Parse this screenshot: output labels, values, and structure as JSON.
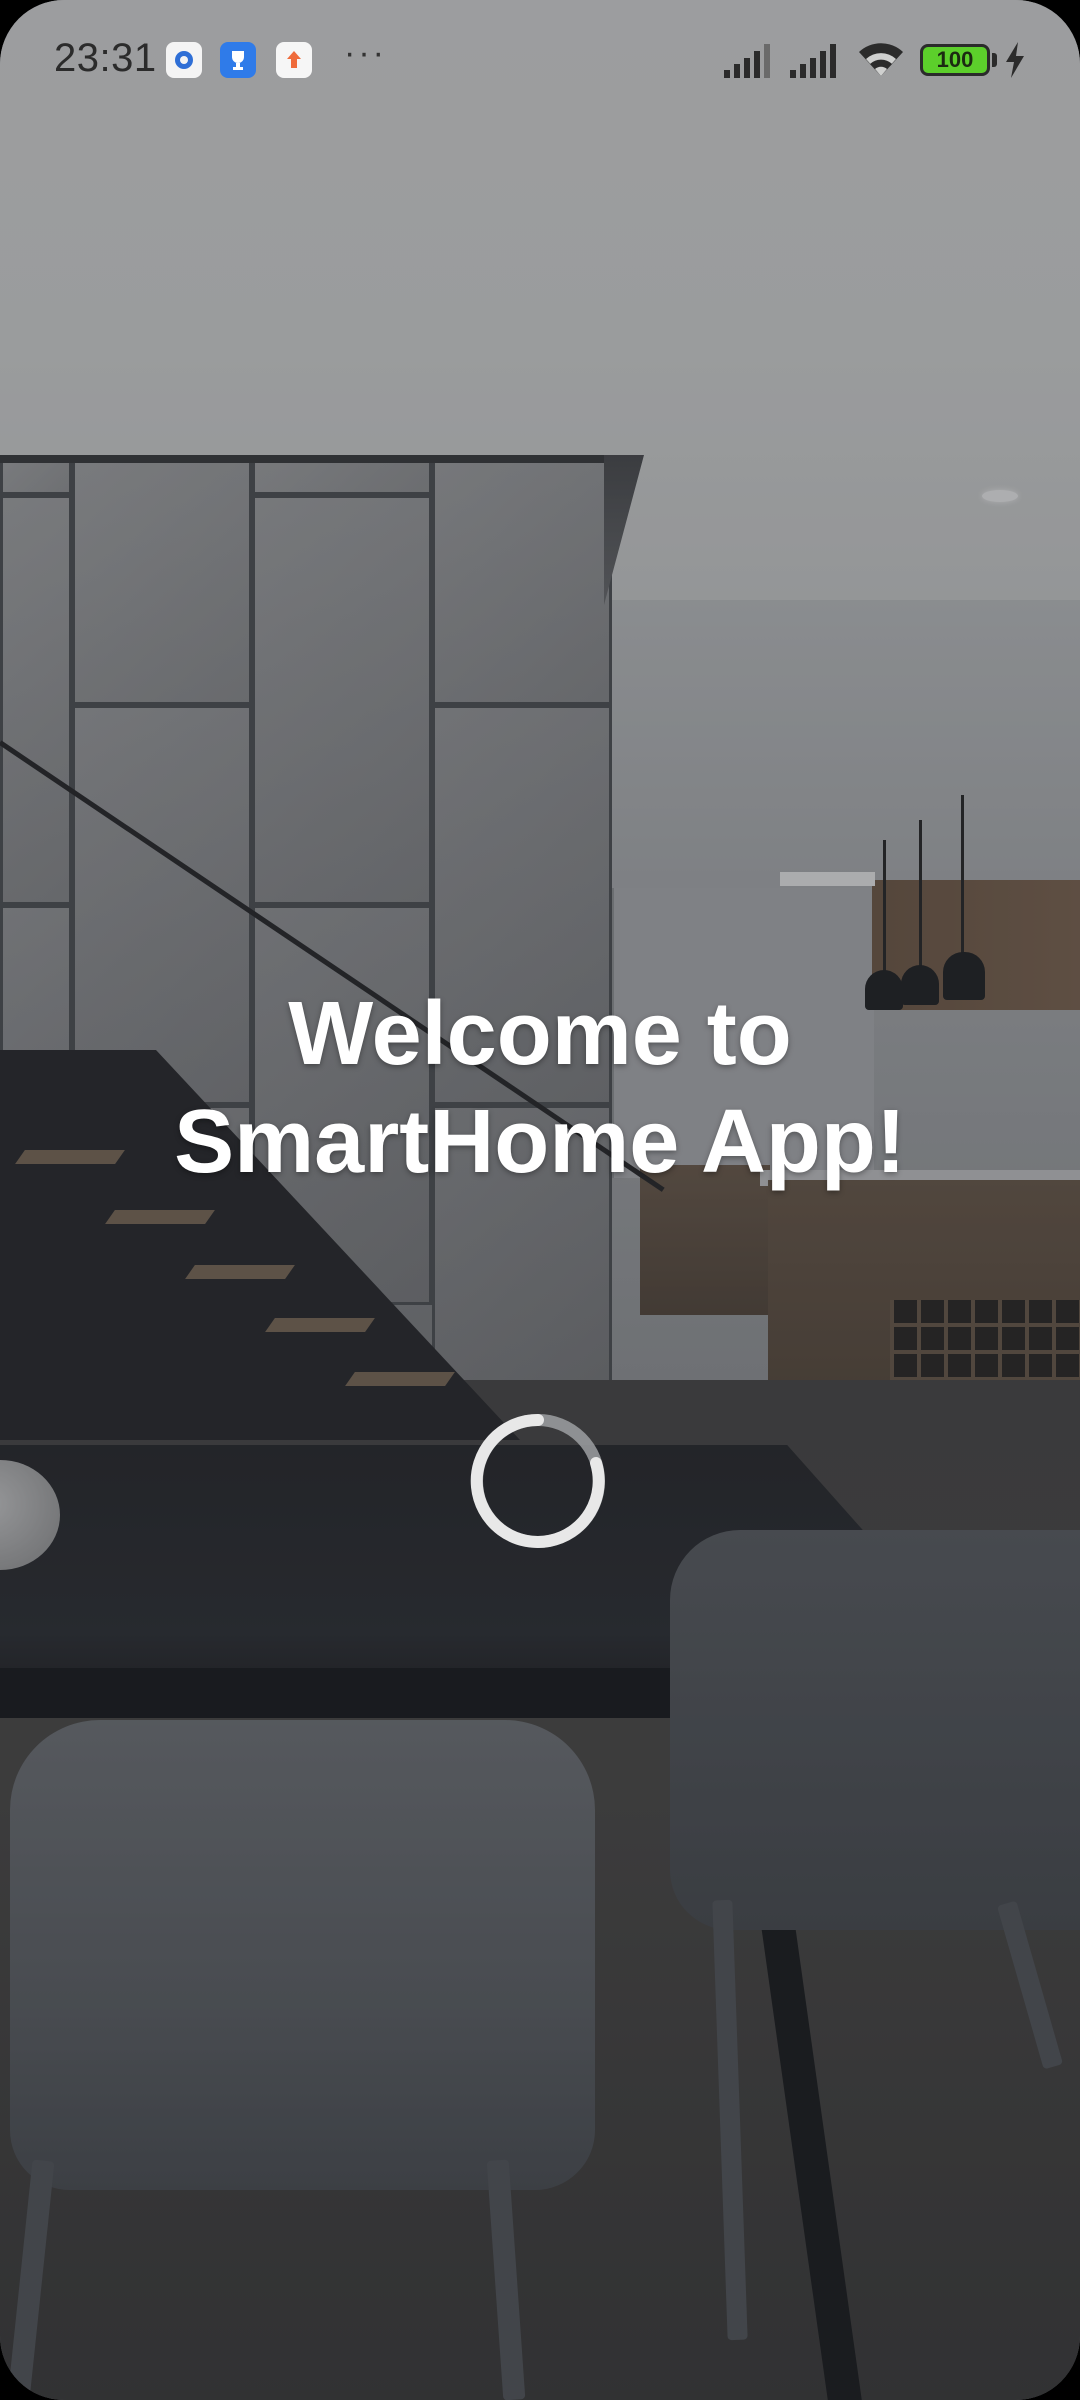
{
  "status_bar": {
    "time": "23:31",
    "notification_icons": [
      "settings-app-icon",
      "trophy-app-icon",
      "upload-app-icon"
    ],
    "overflow": "···",
    "battery_level": "100",
    "charging": true
  },
  "welcome": {
    "title": "Welcome to SmartHome App!"
  },
  "loading": {
    "state": "loading"
  },
  "colors": {
    "title_text": "#ffffff",
    "spinner_track": "#9ea0a2",
    "spinner_arc": "#e8e8e8",
    "battery_fill": "#5ccf2b",
    "notif_blue": "#2f7be9",
    "notif_orange": "#ef6b3b"
  }
}
